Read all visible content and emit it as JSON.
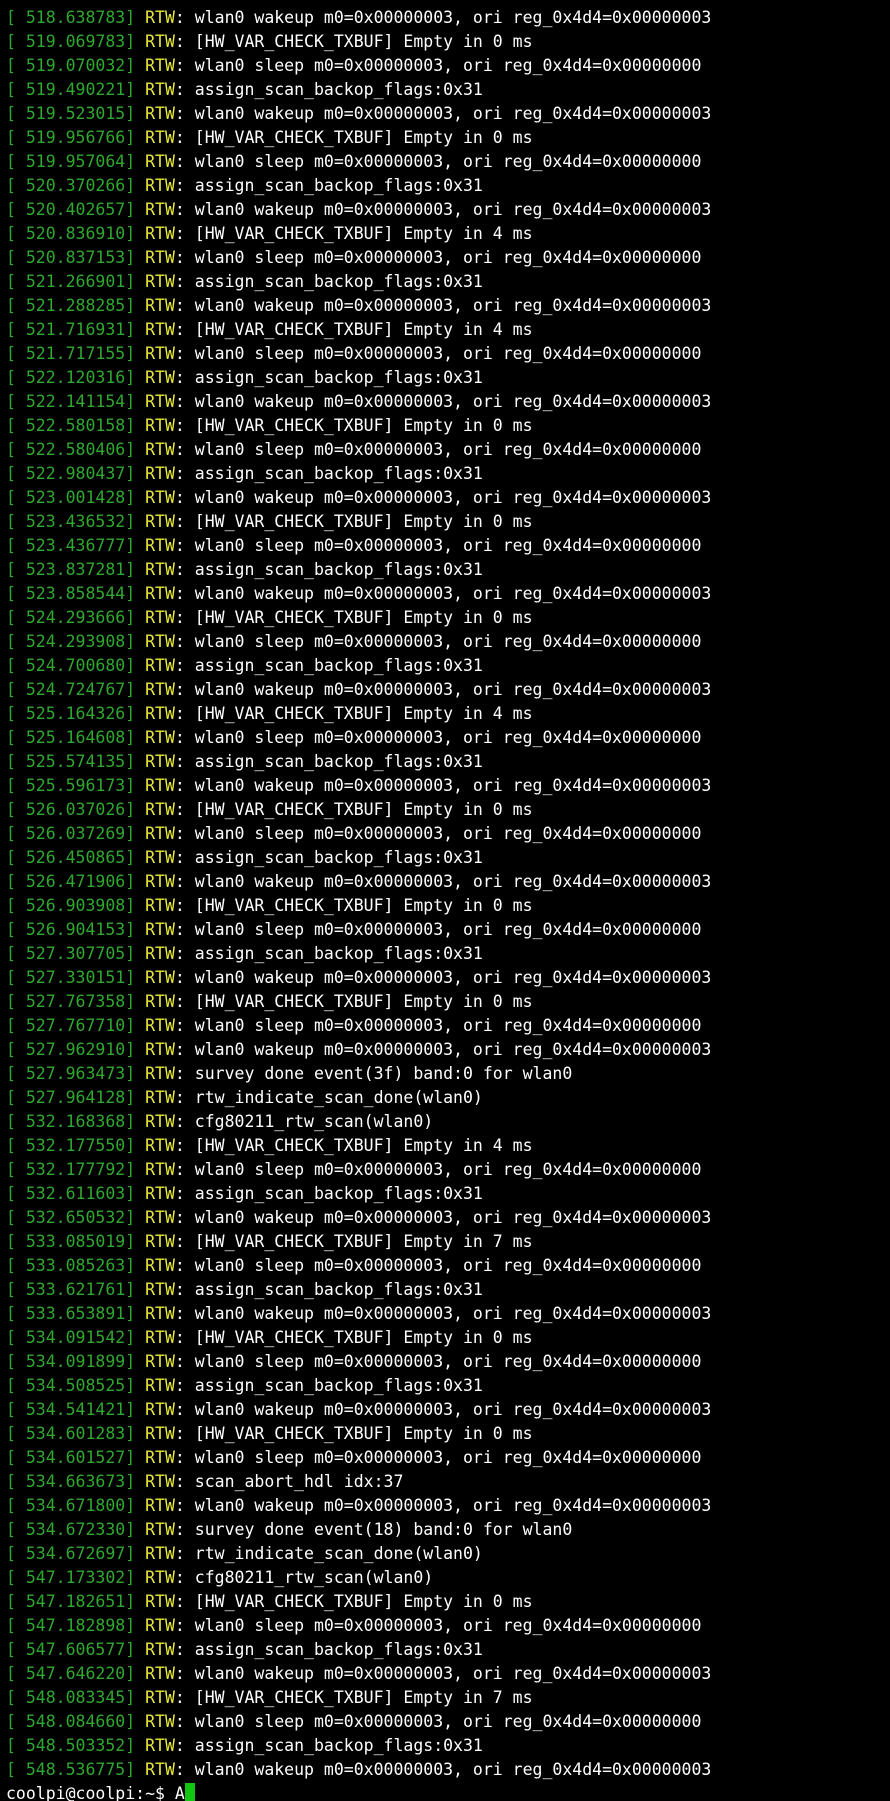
{
  "colors": {
    "background": "#000000",
    "timestamp": "#2fa82f",
    "tag": "#e8e83a",
    "message": "#ffffff",
    "cursor": "#13c613"
  },
  "tag": "RTW",
  "log": [
    {
      "ts": "518.638783",
      "msg": "wlan0 wakeup m0=0x00000003, ori reg_0x4d4=0x00000003"
    },
    {
      "ts": "519.069783",
      "msg": "[HW_VAR_CHECK_TXBUF] Empty in 0 ms"
    },
    {
      "ts": "519.070032",
      "msg": "wlan0 sleep m0=0x00000003, ori reg_0x4d4=0x00000000"
    },
    {
      "ts": "519.490221",
      "msg": "assign_scan_backop_flags:0x31"
    },
    {
      "ts": "519.523015",
      "msg": "wlan0 wakeup m0=0x00000003, ori reg_0x4d4=0x00000003"
    },
    {
      "ts": "519.956766",
      "msg": "[HW_VAR_CHECK_TXBUF] Empty in 0 ms"
    },
    {
      "ts": "519.957064",
      "msg": "wlan0 sleep m0=0x00000003, ori reg_0x4d4=0x00000000"
    },
    {
      "ts": "520.370266",
      "msg": "assign_scan_backop_flags:0x31"
    },
    {
      "ts": "520.402657",
      "msg": "wlan0 wakeup m0=0x00000003, ori reg_0x4d4=0x00000003"
    },
    {
      "ts": "520.836910",
      "msg": "[HW_VAR_CHECK_TXBUF] Empty in 4 ms"
    },
    {
      "ts": "520.837153",
      "msg": "wlan0 sleep m0=0x00000003, ori reg_0x4d4=0x00000000"
    },
    {
      "ts": "521.266901",
      "msg": "assign_scan_backop_flags:0x31"
    },
    {
      "ts": "521.288285",
      "msg": "wlan0 wakeup m0=0x00000003, ori reg_0x4d4=0x00000003"
    },
    {
      "ts": "521.716931",
      "msg": "[HW_VAR_CHECK_TXBUF] Empty in 4 ms"
    },
    {
      "ts": "521.717155",
      "msg": "wlan0 sleep m0=0x00000003, ori reg_0x4d4=0x00000000"
    },
    {
      "ts": "522.120316",
      "msg": "assign_scan_backop_flags:0x31"
    },
    {
      "ts": "522.141154",
      "msg": "wlan0 wakeup m0=0x00000003, ori reg_0x4d4=0x00000003"
    },
    {
      "ts": "522.580158",
      "msg": "[HW_VAR_CHECK_TXBUF] Empty in 0 ms"
    },
    {
      "ts": "522.580406",
      "msg": "wlan0 sleep m0=0x00000003, ori reg_0x4d4=0x00000000"
    },
    {
      "ts": "522.980437",
      "msg": "assign_scan_backop_flags:0x31"
    },
    {
      "ts": "523.001428",
      "msg": "wlan0 wakeup m0=0x00000003, ori reg_0x4d4=0x00000003"
    },
    {
      "ts": "523.436532",
      "msg": "[HW_VAR_CHECK_TXBUF] Empty in 0 ms"
    },
    {
      "ts": "523.436777",
      "msg": "wlan0 sleep m0=0x00000003, ori reg_0x4d4=0x00000000"
    },
    {
      "ts": "523.837281",
      "msg": "assign_scan_backop_flags:0x31"
    },
    {
      "ts": "523.858544",
      "msg": "wlan0 wakeup m0=0x00000003, ori reg_0x4d4=0x00000003"
    },
    {
      "ts": "524.293666",
      "msg": "[HW_VAR_CHECK_TXBUF] Empty in 0 ms"
    },
    {
      "ts": "524.293908",
      "msg": "wlan0 sleep m0=0x00000003, ori reg_0x4d4=0x00000000"
    },
    {
      "ts": "524.700680",
      "msg": "assign_scan_backop_flags:0x31"
    },
    {
      "ts": "524.724767",
      "msg": "wlan0 wakeup m0=0x00000003, ori reg_0x4d4=0x00000003"
    },
    {
      "ts": "525.164326",
      "msg": "[HW_VAR_CHECK_TXBUF] Empty in 4 ms"
    },
    {
      "ts": "525.164608",
      "msg": "wlan0 sleep m0=0x00000003, ori reg_0x4d4=0x00000000"
    },
    {
      "ts": "525.574135",
      "msg": "assign_scan_backop_flags:0x31"
    },
    {
      "ts": "525.596173",
      "msg": "wlan0 wakeup m0=0x00000003, ori reg_0x4d4=0x00000003"
    },
    {
      "ts": "526.037026",
      "msg": "[HW_VAR_CHECK_TXBUF] Empty in 0 ms"
    },
    {
      "ts": "526.037269",
      "msg": "wlan0 sleep m0=0x00000003, ori reg_0x4d4=0x00000000"
    },
    {
      "ts": "526.450865",
      "msg": "assign_scan_backop_flags:0x31"
    },
    {
      "ts": "526.471906",
      "msg": "wlan0 wakeup m0=0x00000003, ori reg_0x4d4=0x00000003"
    },
    {
      "ts": "526.903908",
      "msg": "[HW_VAR_CHECK_TXBUF] Empty in 0 ms"
    },
    {
      "ts": "526.904153",
      "msg": "wlan0 sleep m0=0x00000003, ori reg_0x4d4=0x00000000"
    },
    {
      "ts": "527.307705",
      "msg": "assign_scan_backop_flags:0x31"
    },
    {
      "ts": "527.330151",
      "msg": "wlan0 wakeup m0=0x00000003, ori reg_0x4d4=0x00000003"
    },
    {
      "ts": "527.767358",
      "msg": "[HW_VAR_CHECK_TXBUF] Empty in 0 ms"
    },
    {
      "ts": "527.767710",
      "msg": "wlan0 sleep m0=0x00000003, ori reg_0x4d4=0x00000000"
    },
    {
      "ts": "527.962910",
      "msg": "wlan0 wakeup m0=0x00000003, ori reg_0x4d4=0x00000003"
    },
    {
      "ts": "527.963473",
      "msg": "survey done event(3f) band:0 for wlan0"
    },
    {
      "ts": "527.964128",
      "msg": "rtw_indicate_scan_done(wlan0)"
    },
    {
      "ts": "532.168368",
      "msg": "cfg80211_rtw_scan(wlan0)"
    },
    {
      "ts": "532.177550",
      "msg": "[HW_VAR_CHECK_TXBUF] Empty in 4 ms"
    },
    {
      "ts": "532.177792",
      "msg": "wlan0 sleep m0=0x00000003, ori reg_0x4d4=0x00000000"
    },
    {
      "ts": "532.611603",
      "msg": "assign_scan_backop_flags:0x31"
    },
    {
      "ts": "532.650532",
      "msg": "wlan0 wakeup m0=0x00000003, ori reg_0x4d4=0x00000003"
    },
    {
      "ts": "533.085019",
      "msg": "[HW_VAR_CHECK_TXBUF] Empty in 7 ms"
    },
    {
      "ts": "533.085263",
      "msg": "wlan0 sleep m0=0x00000003, ori reg_0x4d4=0x00000000"
    },
    {
      "ts": "533.621761",
      "msg": "assign_scan_backop_flags:0x31"
    },
    {
      "ts": "533.653891",
      "msg": "wlan0 wakeup m0=0x00000003, ori reg_0x4d4=0x00000003"
    },
    {
      "ts": "534.091542",
      "msg": "[HW_VAR_CHECK_TXBUF] Empty in 0 ms"
    },
    {
      "ts": "534.091899",
      "msg": "wlan0 sleep m0=0x00000003, ori reg_0x4d4=0x00000000"
    },
    {
      "ts": "534.508525",
      "msg": "assign_scan_backop_flags:0x31"
    },
    {
      "ts": "534.541421",
      "msg": "wlan0 wakeup m0=0x00000003, ori reg_0x4d4=0x00000003"
    },
    {
      "ts": "534.601283",
      "msg": "[HW_VAR_CHECK_TXBUF] Empty in 0 ms"
    },
    {
      "ts": "534.601527",
      "msg": "wlan0 sleep m0=0x00000003, ori reg_0x4d4=0x00000000"
    },
    {
      "ts": "534.663673",
      "msg": "scan_abort_hdl idx:37"
    },
    {
      "ts": "534.671800",
      "msg": "wlan0 wakeup m0=0x00000003, ori reg_0x4d4=0x00000003"
    },
    {
      "ts": "534.672330",
      "msg": "survey done event(18) band:0 for wlan0"
    },
    {
      "ts": "534.672697",
      "msg": "rtw_indicate_scan_done(wlan0)"
    },
    {
      "ts": "547.173302",
      "msg": "cfg80211_rtw_scan(wlan0)"
    },
    {
      "ts": "547.182651",
      "msg": "[HW_VAR_CHECK_TXBUF] Empty in 0 ms"
    },
    {
      "ts": "547.182898",
      "msg": "wlan0 sleep m0=0x00000003, ori reg_0x4d4=0x00000000"
    },
    {
      "ts": "547.606577",
      "msg": "assign_scan_backop_flags:0x31"
    },
    {
      "ts": "547.646220",
      "msg": "wlan0 wakeup m0=0x00000003, ori reg_0x4d4=0x00000003"
    },
    {
      "ts": "548.083345",
      "msg": "[HW_VAR_CHECK_TXBUF] Empty in 7 ms"
    },
    {
      "ts": "548.084660",
      "msg": "wlan0 sleep m0=0x00000003, ori reg_0x4d4=0x00000000"
    },
    {
      "ts": "548.503352",
      "msg": "assign_scan_backop_flags:0x31"
    },
    {
      "ts": "548.536775",
      "msg": "wlan0 wakeup m0=0x00000003, ori reg_0x4d4=0x00000003"
    }
  ],
  "prompt": {
    "text": "coolpi@coolpi:~$ ",
    "input": "A"
  }
}
